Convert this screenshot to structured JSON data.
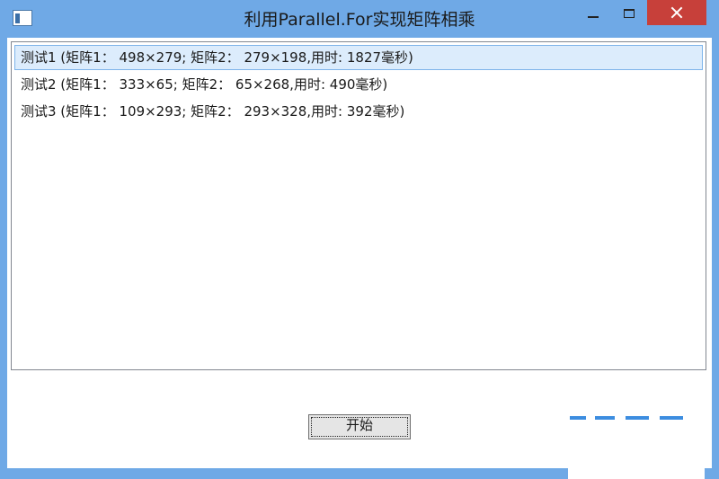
{
  "window": {
    "title": "利用Parallel.For实现矩阵相乘"
  },
  "list": {
    "items": [
      {
        "text": "测试1 (矩阵1： 498×279; 矩阵2： 279×198,用时: 1827毫秒)",
        "selected": true
      },
      {
        "text": "测试2 (矩阵1： 333×65; 矩阵2： 65×268,用时: 490毫秒)",
        "selected": false
      },
      {
        "text": "测试3 (矩阵1： 109×293; 矩阵2： 293×328,用时: 392毫秒)",
        "selected": false
      }
    ]
  },
  "actions": {
    "start_label": "开始"
  },
  "icons": {
    "app": "app-window-icon",
    "minimize": "minimize-icon",
    "maximize": "maximize-icon",
    "close": "close-icon"
  },
  "colors": {
    "titlebar": "#6fa9e6",
    "close_button": "#c7403a",
    "selection_bg": "#dcecfc",
    "selection_border": "#7eb4ea"
  }
}
